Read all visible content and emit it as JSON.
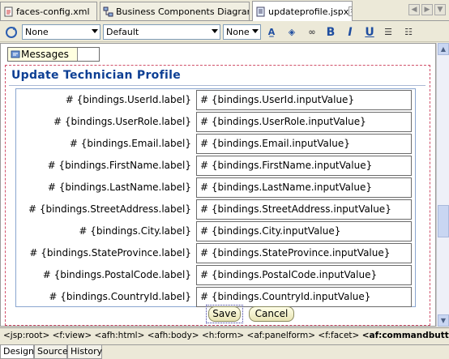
{
  "tabs": [
    {
      "label": "faces-config.xml",
      "active": false
    },
    {
      "label": "Business Components Diagram",
      "active": false
    },
    {
      "label": "updateprofile.jspx",
      "active": true
    }
  ],
  "toolbar": {
    "style_combo": "None",
    "font_combo": "Default",
    "size_combo": "None",
    "buttons": [
      "highlight-icon",
      "fill-color-icon",
      "link-icon",
      "bold-icon",
      "italic-icon",
      "underline-icon",
      "ordered-list-icon",
      "unordered-list-icon"
    ]
  },
  "messages_label": "Messages",
  "form": {
    "title": "Update Technician Profile",
    "rows": [
      {
        "label": "# {bindings.UserId.label}",
        "value": "# {bindings.UserId.inputValue}"
      },
      {
        "label": "# {bindings.UserRole.label}",
        "value": "# {bindings.UserRole.inputValue}"
      },
      {
        "label": "# {bindings.Email.label}",
        "value": "# {bindings.Email.inputValue}"
      },
      {
        "label": "# {bindings.FirstName.label}",
        "value": "# {bindings.FirstName.inputValue}"
      },
      {
        "label": "# {bindings.LastName.label}",
        "value": "# {bindings.LastName.inputValue}"
      },
      {
        "label": "# {bindings.StreetAddress.label}",
        "value": "# {bindings.StreetAddress.inputValue}"
      },
      {
        "label": "# {bindings.City.label}",
        "value": "# {bindings.City.inputValue}"
      },
      {
        "label": "# {bindings.StateProvince.label}",
        "value": "# {bindings.StateProvince.inputValue}"
      },
      {
        "label": "# {bindings.PostalCode.label}",
        "value": "# {bindings.PostalCode.inputValue}"
      },
      {
        "label": "# {bindings.CountryId.label}",
        "value": "# {bindings.CountryId.inputValue}"
      }
    ],
    "save_label": "Save",
    "cancel_label": "Cancel"
  },
  "breadcrumb": "<jsp:root> <f:view> <afh:html> <afh:body> <h:form> <af:panelform> <f:facet>",
  "breadcrumb_selected": "<af:commandbutton>",
  "bottom_tabs": [
    "Design",
    "Source",
    "History"
  ],
  "colors": {
    "title": "#0d3f94",
    "form_border": "#d0506a"
  }
}
